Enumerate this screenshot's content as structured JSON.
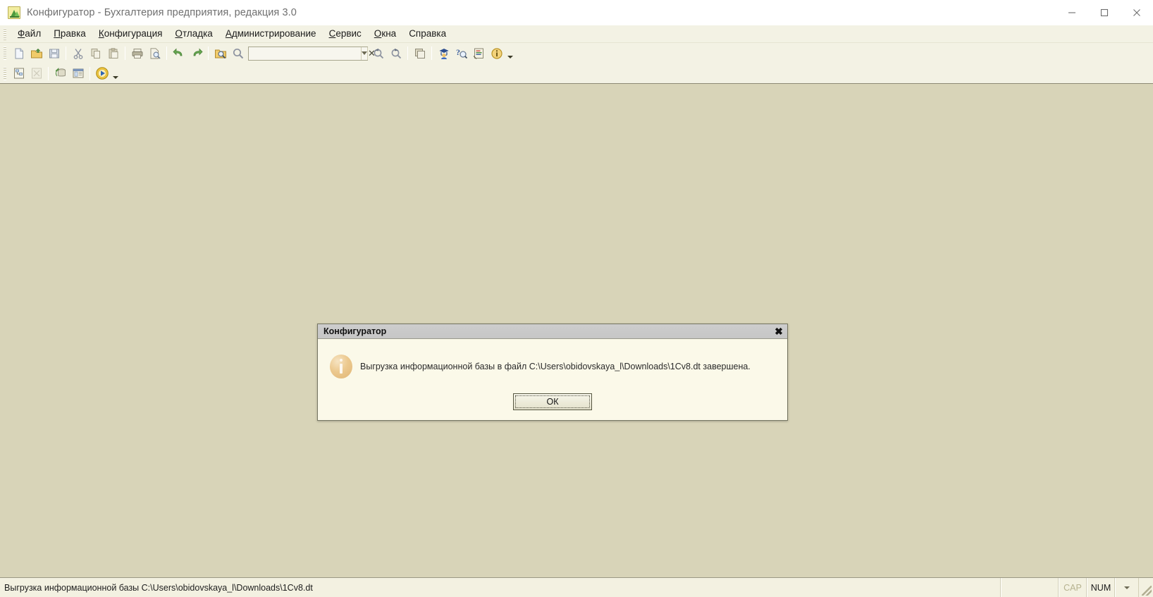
{
  "window": {
    "title": "Конфигуратор - Бухгалтерия предприятия, редакция 3.0",
    "app_icon": "1c-configurator-icon",
    "controls": {
      "minimize": "minimize-icon",
      "maximize": "maximize-icon",
      "close": "close-icon"
    }
  },
  "menubar": {
    "items": [
      {
        "label": "Файл",
        "mnemonic": "Ф"
      },
      {
        "label": "Правка",
        "mnemonic": "П"
      },
      {
        "label": "Конфигурация",
        "mnemonic": "К"
      },
      {
        "label": "Отладка",
        "mnemonic": "О"
      },
      {
        "label": "Администрирование",
        "mnemonic": "А"
      },
      {
        "label": "Сервис",
        "mnemonic": "С"
      },
      {
        "label": "Окна",
        "mnemonic": "О"
      },
      {
        "label": "Справка",
        "mnemonic": ""
      }
    ]
  },
  "toolbar_main": {
    "search": {
      "value": "",
      "placeholder": "",
      "dropdown_icon": "chevron-down-icon",
      "clear_icon": "clear-x-icon"
    },
    "buttons": [
      {
        "name": "new-file-button",
        "icon": "new-document-icon"
      },
      {
        "name": "open-file-button",
        "icon": "open-folder-icon"
      },
      {
        "name": "save-button",
        "icon": "floppy-save-icon"
      },
      {
        "name": "cut-button",
        "icon": "scissors-icon"
      },
      {
        "name": "copy-button",
        "icon": "copy-icon"
      },
      {
        "name": "paste-button",
        "icon": "clipboard-paste-icon"
      },
      {
        "name": "print-button",
        "icon": "printer-icon"
      },
      {
        "name": "print-preview-button",
        "icon": "print-preview-icon"
      },
      {
        "name": "undo-button",
        "icon": "undo-arrow-icon"
      },
      {
        "name": "redo-button",
        "icon": "redo-arrow-icon"
      },
      {
        "name": "find-in-files-button",
        "icon": "folder-search-icon"
      },
      {
        "name": "search-button",
        "icon": "magnifier-icon"
      },
      {
        "name": "find-previous-button",
        "icon": "find-previous-icon"
      },
      {
        "name": "find-next-button",
        "icon": "find-next-icon"
      },
      {
        "name": "windows-button",
        "icon": "cascade-windows-icon"
      },
      {
        "name": "syntax-assistant-button",
        "icon": "graduate-icon"
      },
      {
        "name": "help-search-button",
        "icon": "question-magnifier-icon"
      },
      {
        "name": "help-contents-button",
        "icon": "help-book-icon"
      },
      {
        "name": "about-button",
        "icon": "info-circle-icon"
      }
    ]
  },
  "toolbar_second": {
    "buttons": [
      {
        "name": "configuration-tree-button",
        "icon": "config-tree-icon"
      },
      {
        "name": "configuration-support-button",
        "icon": "config-locked-icon"
      },
      {
        "name": "update-database-config-button",
        "icon": "database-update-icon"
      },
      {
        "name": "config-window-button",
        "icon": "config-window-icon"
      },
      {
        "name": "start-debugging-button",
        "icon": "play-debug-icon"
      }
    ]
  },
  "dialog": {
    "title": "Конфигуратор",
    "close_icon": "close-x-icon",
    "info_icon": "info-icon",
    "message": "Выгрузка информационной базы в файл C:\\Users\\obidovskaya_l\\Downloads\\1Cv8.dt завершена.",
    "ok_label": "ОК"
  },
  "statusbar": {
    "message": "Выгрузка информационной базы C:\\Users\\obidovskaya_l\\Downloads\\1Cv8.dt",
    "cap_label": "CAP",
    "num_label": "NUM",
    "dropdown_icon": "chevron-down-icon",
    "resize_grip": "resize-grip-icon"
  },
  "colors": {
    "window_chrome": "#f3f2e4",
    "workspace": "#d8d4b8",
    "dialog_bg": "#fbf9e9",
    "dialog_title": "#cdcdcd",
    "accent_yellow": "#f2eda0"
  }
}
